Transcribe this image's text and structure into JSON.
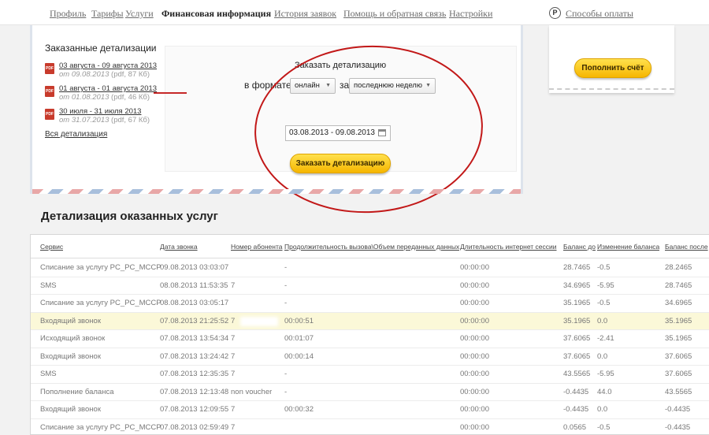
{
  "nav": {
    "items": [
      "Профиль",
      "Тарифы",
      "Услуги",
      "Финансовая информация",
      "История заявок",
      "Помощь и обратная связь",
      "Настройки"
    ],
    "active": "Финансовая информация",
    "payment_icon": "Р",
    "payment_label": "Способы оплаты"
  },
  "details": {
    "heading": "Заказанные детализации",
    "items": [
      {
        "link": "03 августа - 09 августа 2013",
        "date": "от 09.08.2013",
        "meta": "(pdf, 87 Кб)"
      },
      {
        "link": "01 августа - 01 августа 2013",
        "date": "от 01.08.2013",
        "meta": "(pdf, 46 Кб)"
      },
      {
        "link": "30 июля - 31 июля 2013",
        "date": "от 31.07.2013",
        "meta": "(pdf, 67 Кб)"
      }
    ],
    "all_link": "Вся детализация",
    "pdf_icon": "PDF"
  },
  "order": {
    "title": "Заказать детализацию",
    "format_label": "в формате",
    "format_value": "онлайн",
    "period_label": "за",
    "period_value": "последнюю неделю",
    "date_range": "03.08.2013 - 09.08.2013",
    "button": "Заказать детализацию",
    "annotation_color": "#c21818"
  },
  "balance": {
    "topup_button": "Пополнить счёт"
  },
  "section": {
    "title": "Детализация оказанных услуг"
  },
  "table": {
    "headers": [
      "Сервис",
      "Дата звонка",
      "Номер абонента",
      "Продолжительность вызова\\Объем переданных данных",
      "Длительность интернет сессии",
      "Баланс до",
      "Изменение баланса",
      "Баланс после"
    ],
    "rows": [
      [
        "Списание за услугу PC_PC_MCCP",
        "09.08.2013 03:03:07",
        "",
        "-",
        "00:00:00",
        "28.7465",
        "-0.5",
        "28.2465"
      ],
      [
        "SMS",
        "08.08.2013 11:53:35",
        "7",
        "-",
        "00:00:00",
        "34.6965",
        "-5.95",
        "28.7465"
      ],
      [
        "Списание за услугу PC_PC_MCCP",
        "08.08.2013 03:05:17",
        "",
        "-",
        "00:00:00",
        "35.1965",
        "-0.5",
        "34.6965"
      ],
      [
        "Входящий звонок",
        "07.08.2013 21:25:52",
        "7",
        "00:00:51",
        "00:00:00",
        "35.1965",
        "0.0",
        "35.1965"
      ],
      [
        "Исходящий звонок",
        "07.08.2013 13:54:34",
        "7",
        "00:01:07",
        "00:00:00",
        "37.6065",
        "-2.41",
        "35.1965"
      ],
      [
        "Входящий звонок",
        "07.08.2013 13:24:42",
        "7",
        "00:00:14",
        "00:00:00",
        "37.6065",
        "0.0",
        "37.6065"
      ],
      [
        "SMS",
        "07.08.2013 12:35:35",
        "7",
        "-",
        "00:00:00",
        "43.5565",
        "-5.95",
        "37.6065"
      ],
      [
        "Пополнение баланса",
        "07.08.2013 12:13:48",
        "non voucher",
        "-",
        "00:00:00",
        "-0.4435",
        "44.0",
        "43.5565"
      ],
      [
        "Входящий звонок",
        "07.08.2013 12:09:55",
        "7",
        "00:00:32",
        "00:00:00",
        "-0.4435",
        "0.0",
        "-0.4435"
      ],
      [
        "Списание за услугу PC_PC_MCCP",
        "07.08.2013 02:59:49",
        "7",
        "",
        "00:00:00",
        "0.0565",
        "-0.5",
        "-0.4435"
      ]
    ],
    "highlight_row": 3,
    "highlight_color": "#fbf8d8"
  }
}
